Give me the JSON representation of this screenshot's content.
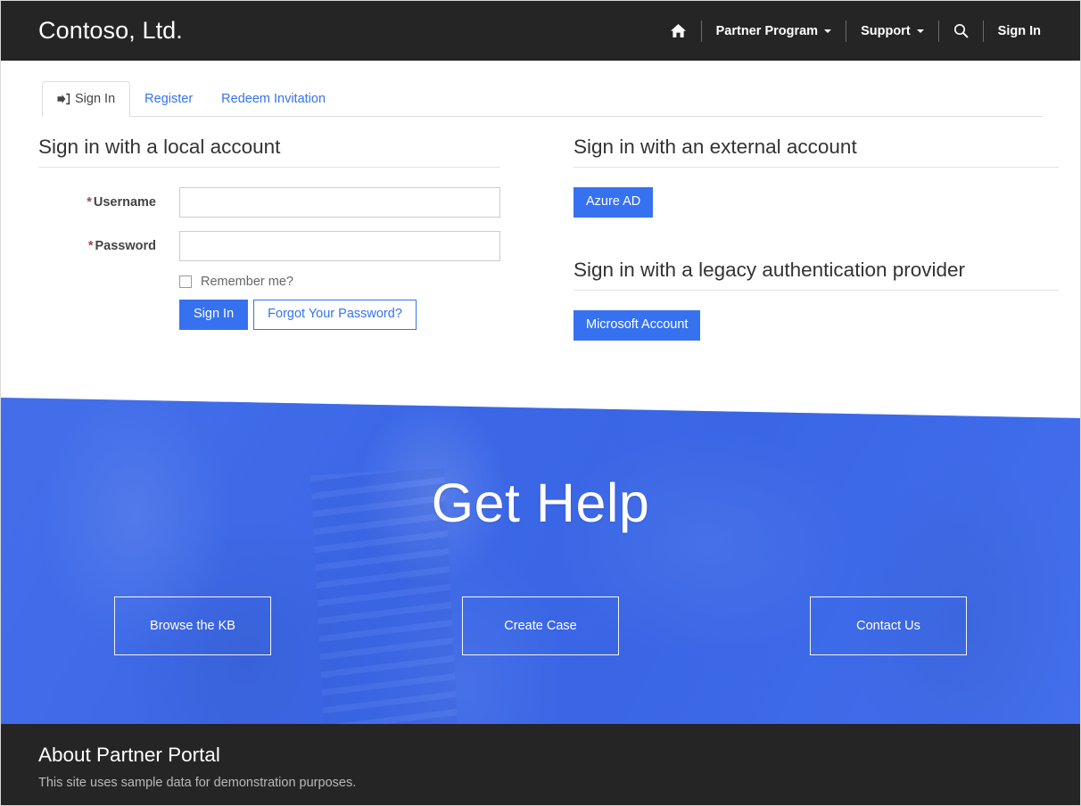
{
  "navbar": {
    "brand": "Contoso, Ltd.",
    "home_icon": "home-icon",
    "search_icon": "search-icon",
    "items": [
      {
        "label": "Partner Program",
        "has_caret": true
      },
      {
        "label": "Support",
        "has_caret": true
      },
      {
        "label": "Sign In",
        "has_caret": false
      }
    ]
  },
  "tabs": [
    {
      "label": "Sign In",
      "active": true,
      "icon": "sign-in-icon"
    },
    {
      "label": "Register",
      "active": false
    },
    {
      "label": "Redeem Invitation",
      "active": false
    }
  ],
  "local_account": {
    "title": "Sign in with a local account",
    "username_label": "Username",
    "password_label": "Password",
    "required_marker": "*",
    "username_value": "",
    "password_value": "",
    "username_placeholder": "",
    "password_placeholder": "",
    "remember_label": "Remember me?",
    "remember_checked": false,
    "sign_in_button": "Sign In",
    "forgot_button": "Forgot Your Password?"
  },
  "external_account": {
    "title": "Sign in with an external account",
    "provider_button": "Azure AD"
  },
  "legacy_account": {
    "title": "Sign in with a legacy authentication provider",
    "provider_button": "Microsoft Account"
  },
  "hero": {
    "title": "Get Help",
    "buttons": [
      {
        "label": "Browse the KB"
      },
      {
        "label": "Create Case"
      },
      {
        "label": "Contact Us"
      }
    ]
  },
  "footer": {
    "title": "About Partner Portal",
    "text": "This site uses sample data for demonstration purposes."
  },
  "colors": {
    "nav_background": "#252526",
    "accent_blue": "#3672f0",
    "hero_blue": "#3b67e6",
    "required_red": "#9b4a4a",
    "footer_background": "#252526"
  }
}
